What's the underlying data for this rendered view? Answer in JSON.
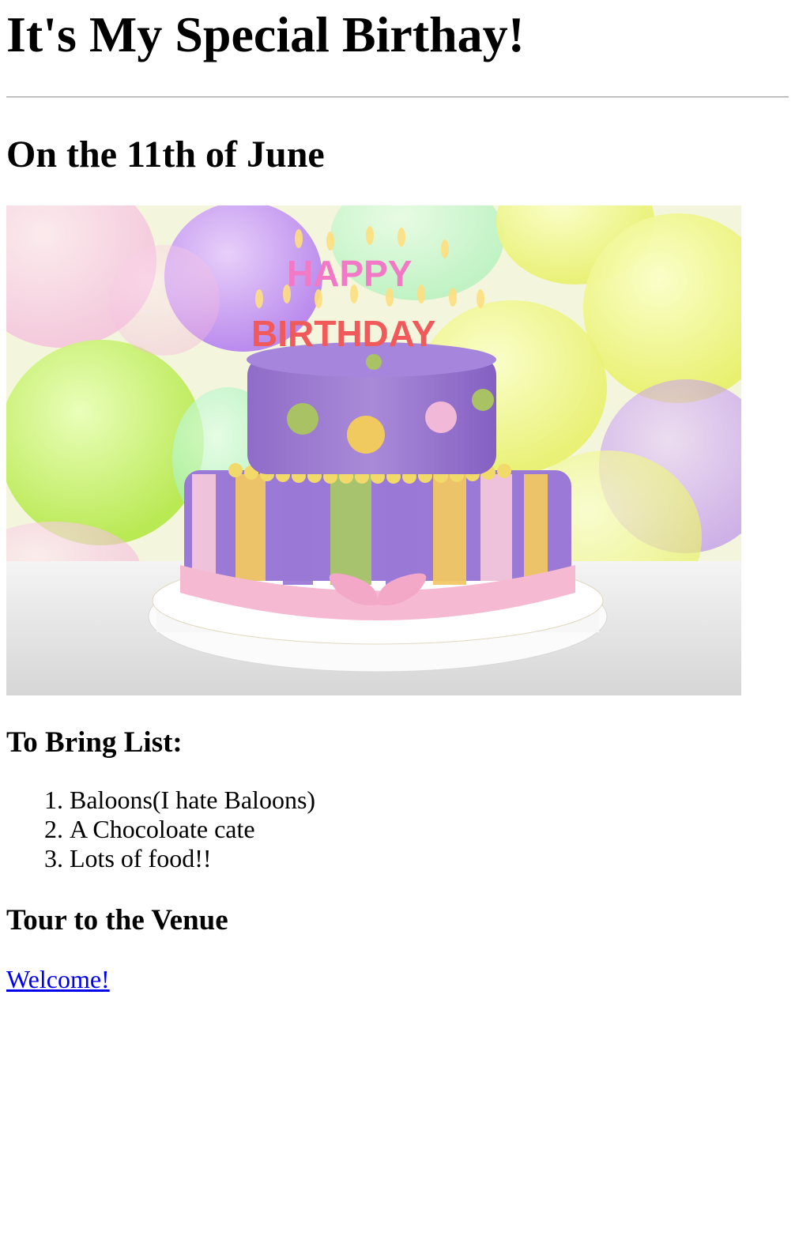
{
  "page": {
    "title": "It's My Special Birthay!",
    "date_heading": "On the 11th of June"
  },
  "image": {
    "alt": "birthday-cake-image",
    "candle_letters_top": "HAPPY",
    "candle_letters_bottom": "BIRTHDAY"
  },
  "bring_list": {
    "heading": "To Bring List:",
    "items": [
      "Baloons(I hate Baloons)",
      "A Chocoloate cate",
      "Lots of food!!"
    ]
  },
  "venue": {
    "heading": "Tour to the Venue",
    "link_label": "Welcome!"
  },
  "colors": {
    "link": "#0000ee",
    "rule": "#a0a0a0"
  }
}
